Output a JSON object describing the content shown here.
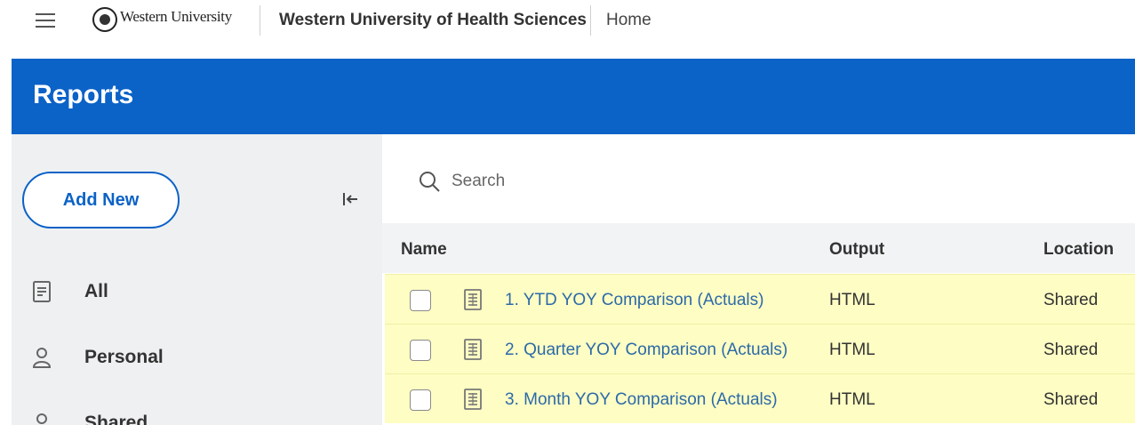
{
  "header": {
    "logo_text": "Western University",
    "org_name": "Western University of Health Sciences",
    "home_label": "Home"
  },
  "banner": {
    "title": "Reports",
    "color": "#0b62c7"
  },
  "sidebar": {
    "add_new_label": "Add New",
    "items": [
      {
        "label": "All",
        "icon": "document-icon"
      },
      {
        "label": "Personal",
        "icon": "person-icon"
      },
      {
        "label": "Shared",
        "icon": "person-icon"
      }
    ]
  },
  "search": {
    "placeholder": "Search"
  },
  "table": {
    "columns": [
      "Name",
      "Output",
      "Location"
    ],
    "rows": [
      {
        "name": "1. YTD YOY Comparison (Actuals)",
        "output": "HTML",
        "location": "Shared"
      },
      {
        "name": "2. Quarter YOY Comparison (Actuals)",
        "output": "HTML",
        "location": "Shared"
      },
      {
        "name": "3. Month YOY Comparison (Actuals)",
        "output": "HTML",
        "location": "Shared"
      }
    ],
    "highlight_color": "#fdfdc4",
    "link_color": "#2c6aa8"
  }
}
